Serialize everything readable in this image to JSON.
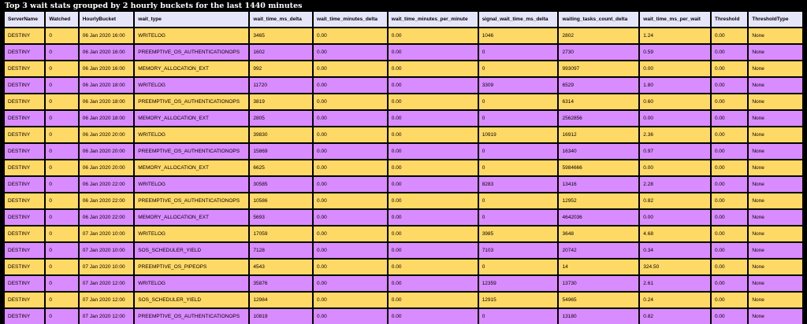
{
  "report": {
    "title": "Top 3 wait stats grouped by 2 hourly buckets for the last 1440 minutes"
  },
  "colors": {
    "background": "#000000",
    "header_row": "#e6e6fa",
    "row_even": "#ffd966",
    "row_odd": "#d98cff"
  },
  "table": {
    "columns": [
      "ServerName",
      "Watched",
      "HourlyBucket",
      "wait_type",
      "wait_time_ms_delta",
      "wait_time_minutes_delta",
      "wait_time_minutes_per_minute",
      "signal_wait_time_ms_delta",
      "waiting_tasks_count_delta",
      "wait_time_ms_per_wait",
      "Threshold",
      "ThresholdType"
    ],
    "rows": [
      [
        "DESTINY",
        "0",
        "06 Jan 2020 16:00",
        "WRITELOG",
        "3465",
        "0.00",
        "0.00",
        "1046",
        "2802",
        "1.24",
        "0.00",
        "None"
      ],
      [
        "DESTINY",
        "0",
        "06 Jan 2020 16:00",
        "PREEMPTIVE_OS_AUTHENTICATIONOPS",
        "1602",
        "0.00",
        "0.00",
        "0",
        "2730",
        "0.59",
        "0.00",
        "None"
      ],
      [
        "DESTINY",
        "0",
        "06 Jan 2020 16:00",
        "MEMORY_ALLOCATION_EXT",
        "992",
        "0.00",
        "0.00",
        "0",
        "993097",
        "0.00",
        "0.00",
        "None"
      ],
      [
        "DESTINY",
        "0",
        "06 Jan 2020 18:00",
        "WRITELOG",
        "11720",
        "0.00",
        "0.00",
        "3309",
        "6529",
        "1.80",
        "0.00",
        "None"
      ],
      [
        "DESTINY",
        "0",
        "06 Jan 2020 18:00",
        "PREEMPTIVE_OS_AUTHENTICATIONOPS",
        "3819",
        "0.00",
        "0.00",
        "0",
        "6314",
        "0.60",
        "0.00",
        "None"
      ],
      [
        "DESTINY",
        "0",
        "06 Jan 2020 18:00",
        "MEMORY_ALLOCATION_EXT",
        "2805",
        "0.00",
        "0.00",
        "0",
        "2562856",
        "0.00",
        "0.00",
        "None"
      ],
      [
        "DESTINY",
        "0",
        "06 Jan 2020 20:00",
        "WRITELOG",
        "39830",
        "0.00",
        "0.00",
        "10919",
        "16912",
        "2.36",
        "0.00",
        "None"
      ],
      [
        "DESTINY",
        "0",
        "06 Jan 2020 20:00",
        "PREEMPTIVE_OS_AUTHENTICATIONOPS",
        "15869",
        "0.00",
        "0.00",
        "0",
        "16340",
        "0.97",
        "0.00",
        "None"
      ],
      [
        "DESTINY",
        "0",
        "06 Jan 2020 20:00",
        "MEMORY_ALLOCATION_EXT",
        "6625",
        "0.00",
        "0.00",
        "0",
        "5984666",
        "0.00",
        "0.00",
        "None"
      ],
      [
        "DESTINY",
        "0",
        "06 Jan 2020 22:00",
        "WRITELOG",
        "30585",
        "0.00",
        "0.00",
        "8283",
        "13416",
        "2.28",
        "0.00",
        "None"
      ],
      [
        "DESTINY",
        "0",
        "06 Jan 2020 22:00",
        "PREEMPTIVE_OS_AUTHENTICATIONOPS",
        "10586",
        "0.00",
        "0.00",
        "0",
        "12952",
        "0.82",
        "0.00",
        "None"
      ],
      [
        "DESTINY",
        "0",
        "06 Jan 2020 22:00",
        "MEMORY_ALLOCATION_EXT",
        "5693",
        "0.00",
        "0.00",
        "0",
        "4642036",
        "0.00",
        "0.00",
        "None"
      ],
      [
        "DESTINY",
        "0",
        "07 Jan 2020 10:00",
        "WRITELOG",
        "17059",
        "0.00",
        "0.00",
        "3985",
        "3648",
        "4.68",
        "0.00",
        "None"
      ],
      [
        "DESTINY",
        "0",
        "07 Jan 2020 10:00",
        "SOS_SCHEDULER_YIELD",
        "7128",
        "0.00",
        "0.00",
        "7103",
        "20742",
        "0.34",
        "0.00",
        "None"
      ],
      [
        "DESTINY",
        "0",
        "07 Jan 2020 10:00",
        "PREEMPTIVE_OS_PIPEOPS",
        "4543",
        "0.00",
        "0.00",
        "0",
        "14",
        "324.50",
        "0.00",
        "None"
      ],
      [
        "DESTINY",
        "0",
        "07 Jan 2020 12:00",
        "WRITELOG",
        "35876",
        "0.00",
        "0.00",
        "12359",
        "13730",
        "2.61",
        "0.00",
        "None"
      ],
      [
        "DESTINY",
        "0",
        "07 Jan 2020 12:00",
        "SOS_SCHEDULER_YIELD",
        "12984",
        "0.00",
        "0.00",
        "12915",
        "54965",
        "0.24",
        "0.00",
        "None"
      ],
      [
        "DESTINY",
        "0",
        "07 Jan 2020 12:00",
        "PREEMPTIVE_OS_AUTHENTICATIONOPS",
        "10819",
        "0.00",
        "0.00",
        "0",
        "13180",
        "0.82",
        "0.00",
        "None"
      ]
    ]
  }
}
